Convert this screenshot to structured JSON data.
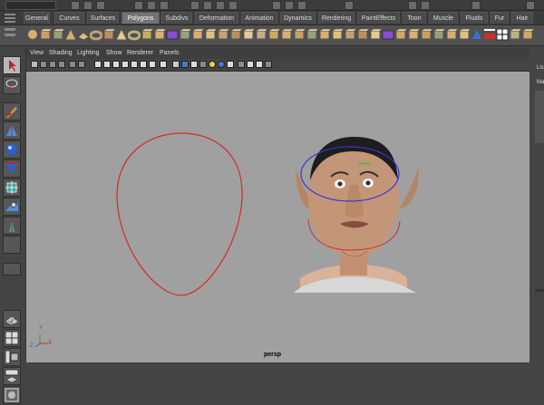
{
  "shelf_tabs": [
    "General",
    "Curves",
    "Surfaces",
    "Polygons",
    "Subdivs",
    "Deformation",
    "Animation",
    "Dynamics",
    "Rendering",
    "PaintEffects",
    "Toon",
    "Muscle",
    "Fluids",
    "Fur",
    "Hair"
  ],
  "active_tab": "Polygons",
  "panel_menu": [
    "View",
    "Shading",
    "Lighting",
    "Show",
    "Renderer",
    "Panels"
  ],
  "viewport": {
    "camera": "persp",
    "axis_x": "X",
    "axis_y": "Y",
    "axis_z": "Z"
  },
  "channel_box": {
    "labels": [
      "Lis",
      "Ma"
    ]
  },
  "colors": {
    "viewport_bg": "#a0a0a0",
    "nurbs_curve": "#d42a2a",
    "selected_curve": "#3a34d8",
    "active_tab": "#737373"
  },
  "icons": {
    "shelf": [
      "sphere",
      "cube",
      "cylinder",
      "cone",
      "plane",
      "torus",
      "prism",
      "pyramid",
      "pipe",
      "helix",
      "soccer-ball",
      "combine",
      "separate",
      "extract",
      "boolean",
      "smooth",
      "average",
      "mirror",
      "bridge",
      "append",
      "split",
      "insert-edge",
      "offset-edge",
      "bevel",
      "extrude",
      "poke",
      "wedge",
      "duplicate-face",
      "merge",
      "collapse",
      "chamfer",
      "delete-edge",
      "triangulate",
      "quadrangulate",
      "fill-hole",
      "reduce",
      "cleanup",
      "uv-editor",
      "planar",
      "cylindrical"
    ],
    "tools": [
      "select-tool",
      "lasso-tool",
      "paint-select-tool",
      "move-tool",
      "rotate-tool",
      "scale-tool",
      "universal-manip-tool",
      "soft-mod-tool",
      "show-manip-tool",
      "last-tool",
      "layout-single-pane",
      "layout-four-pane",
      "layout-outliner",
      "layout-hypergraph",
      "layout-render"
    ]
  }
}
